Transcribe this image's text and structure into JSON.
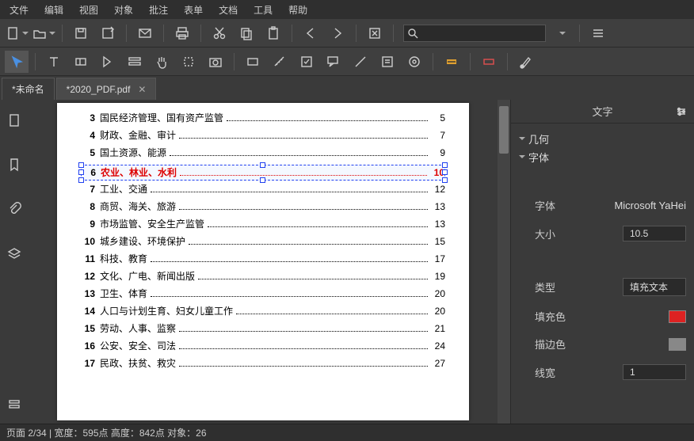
{
  "menu": [
    "文件",
    "编辑",
    "视图",
    "对象",
    "批注",
    "表单",
    "文档",
    "工具",
    "帮助"
  ],
  "tabs": [
    {
      "label": "*未命名",
      "active": false,
      "closable": false
    },
    {
      "label": "*2020_PDF.pdf",
      "active": true,
      "closable": true
    }
  ],
  "props": {
    "title": "文字",
    "sections": {
      "geom": "几何",
      "font": "字体"
    },
    "font_label": "字体",
    "font_value": "Microsoft YaHei",
    "size_label": "大小",
    "size_value": "10.5",
    "type_label": "类型",
    "type_value": "填充文本",
    "fill_label": "填充色",
    "fill_value": "#d22",
    "stroke_label": "描边色",
    "stroke_value": "#888",
    "linew_label": "线宽",
    "linew_value": "1"
  },
  "toc": [
    {
      "n": "3",
      "t": "国民经济管理、国有资产监管",
      "p": "5"
    },
    {
      "n": "4",
      "t": "财政、金融、审计",
      "p": "7"
    },
    {
      "n": "5",
      "t": "国土资源、能源",
      "p": "9"
    },
    {
      "n": "6",
      "t": "农业、林业、水利",
      "p": "10",
      "selected": true
    },
    {
      "n": "7",
      "t": "工业、交通",
      "p": "12"
    },
    {
      "n": "8",
      "t": "商贸、海关、旅游",
      "p": "13"
    },
    {
      "n": "9",
      "t": "市场监管、安全生产监管",
      "p": "13"
    },
    {
      "n": "10",
      "t": "城乡建设、环境保护",
      "p": "15"
    },
    {
      "n": "11",
      "t": "科技、教育",
      "p": "17"
    },
    {
      "n": "12",
      "t": "文化、广电、新闻出版",
      "p": "19"
    },
    {
      "n": "13",
      "t": "卫生、体育",
      "p": "20"
    },
    {
      "n": "14",
      "t": "人口与计划生育、妇女儿童工作",
      "p": "20"
    },
    {
      "n": "15",
      "t": "劳动、人事、监察",
      "p": "21"
    },
    {
      "n": "16",
      "t": "公安、安全、司法",
      "p": "24"
    },
    {
      "n": "17",
      "t": "民政、扶贫、救灾",
      "p": "27"
    }
  ],
  "status": "页面 2/34 | 宽度：595点 高度：842点 对象：26"
}
